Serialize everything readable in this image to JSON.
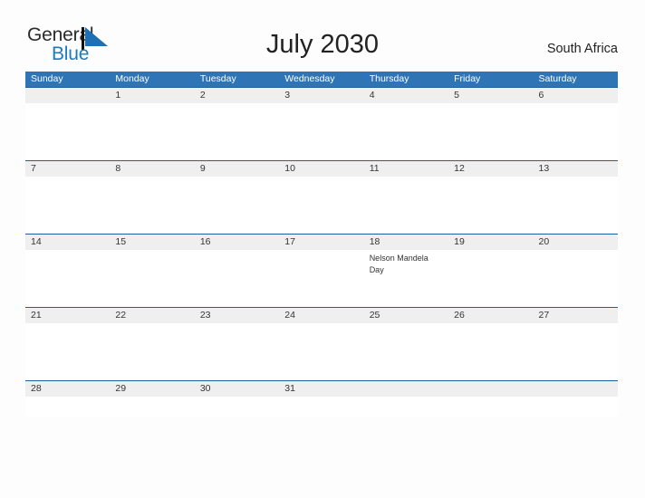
{
  "brand": {
    "word_one": "General",
    "word_two": "Blue",
    "flag_icon": "flag-triangle-icon",
    "color_dark": "#2b2b2b",
    "color_blue": "#1b7ac0"
  },
  "header": {
    "title": "July 2030",
    "location": "South Africa"
  },
  "theme": {
    "header_blue": "#2f75b5",
    "row_border_blue": "#1f5fa0",
    "number_strip_gray": "#efefef",
    "page_background": "#fdfdfd",
    "text_color": "#333333"
  },
  "calendar": {
    "month": "July",
    "year": "2030",
    "weekday_headers": [
      "Sunday",
      "Monday",
      "Tuesday",
      "Wednesday",
      "Thursday",
      "Friday",
      "Saturday"
    ],
    "weeks": [
      {
        "days": [
          {
            "number": "",
            "event": ""
          },
          {
            "number": "1",
            "event": ""
          },
          {
            "number": "2",
            "event": ""
          },
          {
            "number": "3",
            "event": ""
          },
          {
            "number": "4",
            "event": ""
          },
          {
            "number": "5",
            "event": ""
          },
          {
            "number": "6",
            "event": ""
          }
        ]
      },
      {
        "days": [
          {
            "number": "7",
            "event": ""
          },
          {
            "number": "8",
            "event": ""
          },
          {
            "number": "9",
            "event": ""
          },
          {
            "number": "10",
            "event": ""
          },
          {
            "number": "11",
            "event": ""
          },
          {
            "number": "12",
            "event": ""
          },
          {
            "number": "13",
            "event": ""
          }
        ]
      },
      {
        "days": [
          {
            "number": "14",
            "event": ""
          },
          {
            "number": "15",
            "event": ""
          },
          {
            "number": "16",
            "event": ""
          },
          {
            "number": "17",
            "event": ""
          },
          {
            "number": "18",
            "event": "Nelson Mandela Day"
          },
          {
            "number": "19",
            "event": ""
          },
          {
            "number": "20",
            "event": ""
          }
        ]
      },
      {
        "days": [
          {
            "number": "21",
            "event": ""
          },
          {
            "number": "22",
            "event": ""
          },
          {
            "number": "23",
            "event": ""
          },
          {
            "number": "24",
            "event": ""
          },
          {
            "number": "25",
            "event": ""
          },
          {
            "number": "26",
            "event": ""
          },
          {
            "number": "27",
            "event": ""
          }
        ]
      },
      {
        "days": [
          {
            "number": "28",
            "event": ""
          },
          {
            "number": "29",
            "event": ""
          },
          {
            "number": "30",
            "event": ""
          },
          {
            "number": "31",
            "event": ""
          },
          {
            "number": "",
            "event": ""
          },
          {
            "number": "",
            "event": ""
          },
          {
            "number": "",
            "event": ""
          }
        ]
      }
    ]
  }
}
